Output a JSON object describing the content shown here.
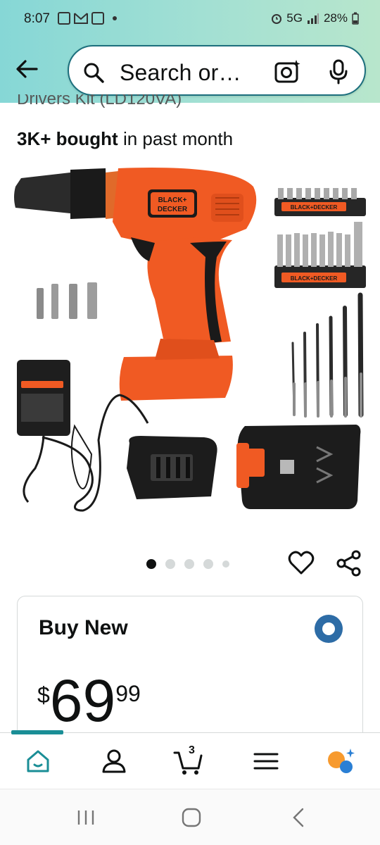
{
  "status_bar": {
    "time": "8:07",
    "network": "5G",
    "battery": "28%"
  },
  "search": {
    "text": "Search or…"
  },
  "product": {
    "title_fragment": "Drivers Kit (LD120VA)",
    "bought_bold": "3K+ bought",
    "bought_rest": " in past month",
    "brand_label": "BLACK+DECKER",
    "image_count": 5,
    "active_image": 1
  },
  "buy_box": {
    "title": "Buy New",
    "price_symbol": "$",
    "price_whole": "69",
    "price_fraction": "99",
    "selected": true
  },
  "bottom_nav": {
    "items": [
      "home-icon",
      "account-icon",
      "cart-icon",
      "menu-icon",
      "rufus-icon"
    ],
    "cart_count": "3"
  },
  "colors": {
    "accent": "#1a8e96",
    "drill_orange": "#f05a23",
    "radio_blue": "#2d6ca6"
  }
}
